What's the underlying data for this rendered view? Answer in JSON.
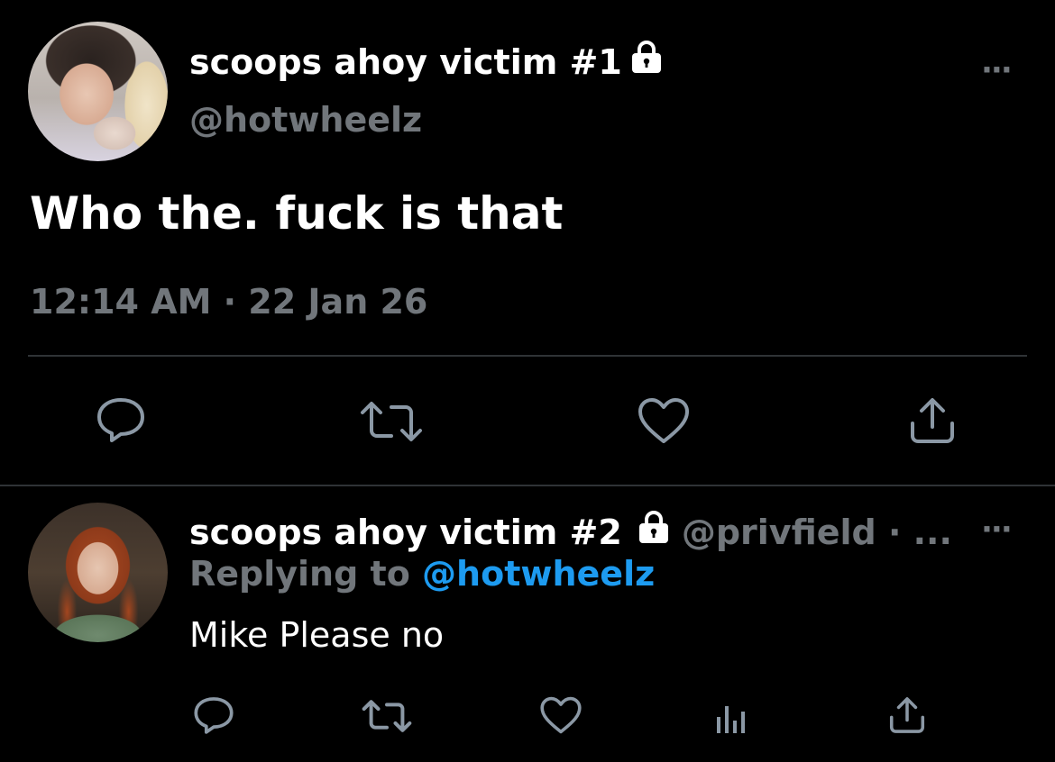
{
  "tweet": {
    "author_name": "scoops ahoy victim #1",
    "author_handle": "@hotwheelz",
    "text": "Who the. fuck is that",
    "timestamp": "12:14 AM · 22 Jan 26",
    "more_label": "···",
    "icons": [
      "reply-icon",
      "retweet-icon",
      "like-icon",
      "share-icon"
    ]
  },
  "reply": {
    "author_name": "scoops ahoy victim #2",
    "author_handle": "@privfield · ...",
    "replying_prefix": "Replying to",
    "replying_mention": "@hotwheelz",
    "text": "Mike Please no",
    "more_label": "···",
    "icons": [
      "reply-icon",
      "retweet-icon",
      "like-icon",
      "analytics-icon",
      "share-icon"
    ]
  },
  "colors": {
    "background": "#000000",
    "primary_text": "#ffffff",
    "secondary_text": "#71767b",
    "link": "#1d9bf0",
    "divider": "#2f3336"
  }
}
